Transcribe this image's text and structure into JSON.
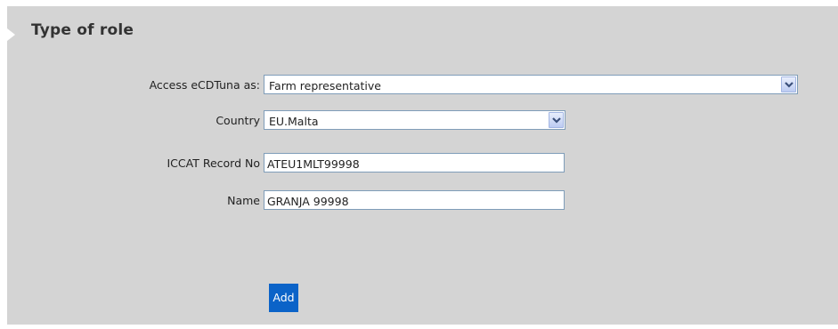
{
  "section": {
    "title": "Type of role"
  },
  "form": {
    "access": {
      "label": "Access eCDTuna as:",
      "value": "Farm representative"
    },
    "country": {
      "label": "Country",
      "value": "EU.Malta"
    },
    "iccat_record": {
      "label": "ICCAT Record No",
      "value": "ATEU1MLT99998"
    },
    "name": {
      "label": "Name",
      "value": "GRANJA 99998"
    },
    "add_label": "Add"
  },
  "colors": {
    "panel": "#d4d4d4",
    "button": "#0b63c8",
    "input_border": "#7f9db9"
  }
}
